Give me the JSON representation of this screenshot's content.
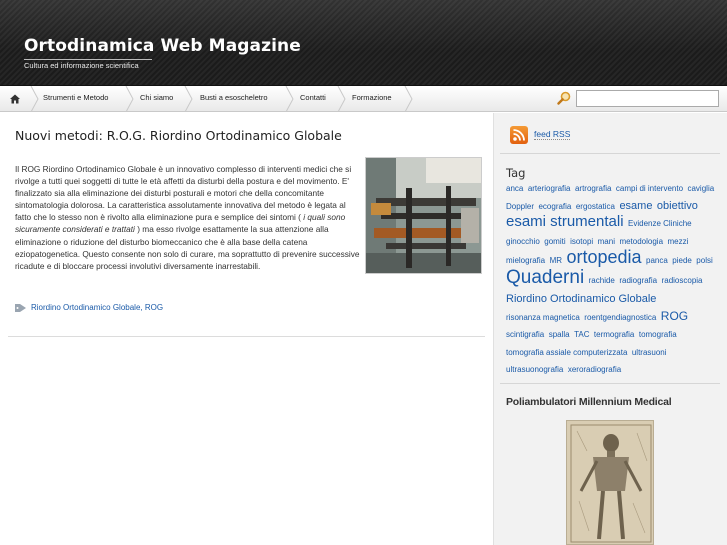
{
  "header": {
    "title": "Ortodinamica Web Magazine",
    "tagline": "Cultura ed informazione scientifica"
  },
  "nav": {
    "home_icon": "home-icon",
    "items": [
      {
        "label": "Strumenti e Metodo"
      },
      {
        "label": "Chi siamo"
      },
      {
        "label": "Busti a esoscheletro"
      },
      {
        "label": "Contatti"
      },
      {
        "label": "Formazione"
      }
    ],
    "search_icon": "magnifier-icon",
    "search_value": ""
  },
  "post": {
    "title": "Nuovi metodi: R.O.G. Riordino Ortodinamico Globale",
    "body_1": "Il ROG Riordino Ortodinamico Globale è un innovativo complesso di interventi medici che si rivolge a tutti quei soggetti di tutte le età affetti da disturbi della postura e del movimento. E'  finalizzato sia alla eliminazione dei disturbi posturali e motori che della concomitante sintomatologia dolorosa. La caratteristica assolutamente innovativa del metodo è legata al fatto che lo stesso non è rivolto alla eliminazione pura e semplice dei sintomi ( ",
    "body_em": "i quali sono sicuramente considerati e trattati",
    "body_2": " ) ma esso rivolge esattamente la sua attenzione alla eliminazione o riduzione del disturbo biomeccanico che è alla base della catena eziopatogenetica. Questo consente non solo di curare, ma soprattutto di prevenire successive ricadute e di bloccare processi involutivi diversamente inarrestabili.",
    "tags_text": "Riordino Ortodinamico Globale, ROG"
  },
  "sidebar": {
    "rss_label": "feed RSS",
    "tag_heading": "Tag",
    "tags": [
      {
        "t": "anca",
        "s": 8
      },
      {
        "t": "arteriografia",
        "s": 8
      },
      {
        "t": "artrografia",
        "s": 8
      },
      {
        "t": "campi di intervento",
        "s": 8
      },
      {
        "t": "caviglia",
        "s": 8
      },
      {
        "t": "Doppler",
        "s": 8
      },
      {
        "t": "ecografia",
        "s": 8
      },
      {
        "t": "ergostatica",
        "s": 8
      },
      {
        "t": "esame",
        "s": 11
      },
      {
        "t": "obiettivo",
        "s": 11
      },
      {
        "t": "esami strumentali",
        "s": 15
      },
      {
        "t": "Evidenze Cliniche",
        "s": 8
      },
      {
        "t": "ginocchio",
        "s": 8
      },
      {
        "t": "gomiti",
        "s": 8
      },
      {
        "t": "isotopi",
        "s": 8
      },
      {
        "t": "mani",
        "s": 8
      },
      {
        "t": "metodologia",
        "s": 8
      },
      {
        "t": "mezzi",
        "s": 8
      },
      {
        "t": "mielografia",
        "s": 8
      },
      {
        "t": "MR",
        "s": 8
      },
      {
        "t": "ortopedia",
        "s": 18
      },
      {
        "t": "panca",
        "s": 8
      },
      {
        "t": "piede",
        "s": 8
      },
      {
        "t": "polsi",
        "s": 8
      },
      {
        "t": "Quaderni",
        "s": 19
      },
      {
        "t": "rachide",
        "s": 8
      },
      {
        "t": "radiografia",
        "s": 8
      },
      {
        "t": "radioscopia",
        "s": 8
      },
      {
        "t": "Riordino Ortodinamico Globale",
        "s": 11
      },
      {
        "t": "risonanza magnetica",
        "s": 8
      },
      {
        "t": "roentgendiagnostica",
        "s": 8
      },
      {
        "t": "ROG",
        "s": 12
      },
      {
        "t": "scintigrafia",
        "s": 8
      },
      {
        "t": "spalla",
        "s": 8
      },
      {
        "t": "TAC",
        "s": 8
      },
      {
        "t": "termografia",
        "s": 8
      },
      {
        "t": "tomografia",
        "s": 8
      },
      {
        "t": "tomografia assiale computerizzata",
        "s": 8
      },
      {
        "t": "ultrasuoni",
        "s": 8
      },
      {
        "t": "ultrasuonografia",
        "s": 8
      },
      {
        "t": "xeroradiografia",
        "s": 8
      }
    ],
    "widget_title": "Poliambulatori Millennium Medical"
  },
  "colors": {
    "link": "#1a5aa8",
    "header_bg": "#1f1f1f",
    "sidebar_bg": "#f2f2f2"
  }
}
